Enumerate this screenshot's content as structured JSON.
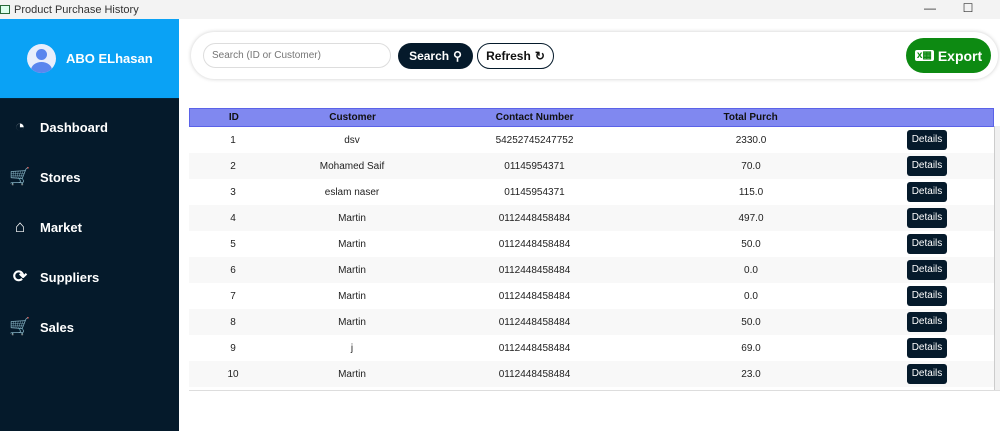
{
  "window": {
    "title": "Product Purchase History"
  },
  "sidebar": {
    "user": "ABO ELhasan",
    "items": [
      {
        "label": "Dashboard",
        "icon": "dashboard-icon"
      },
      {
        "label": "Stores",
        "icon": "cart-box-icon"
      },
      {
        "label": "Market",
        "icon": "store-icon"
      },
      {
        "label": "Suppliers",
        "icon": "supplier-cycle-icon"
      },
      {
        "label": "Sales",
        "icon": "sales-cart-icon"
      }
    ]
  },
  "toolbar": {
    "search_placeholder": "Search (ID or Customer)",
    "search_label": "Search",
    "refresh_label": "Refresh",
    "export_label": "Export"
  },
  "table": {
    "headers": [
      "ID",
      "Customer",
      "Contact Number",
      "Total Purch",
      ""
    ],
    "details_label": "Details",
    "rows": [
      [
        "1",
        "dsv",
        "54252745247752",
        "2330.0"
      ],
      [
        "2",
        "Mohamed Saif",
        "01145954371",
        "70.0"
      ],
      [
        "3",
        "eslam naser",
        "01145954371",
        "115.0"
      ],
      [
        "4",
        "Martin",
        "0112448458484",
        "497.0"
      ],
      [
        "5",
        "Martin",
        "0112448458484",
        "50.0"
      ],
      [
        "6",
        "Martin",
        "0112448458484",
        "0.0"
      ],
      [
        "7",
        "Martin",
        "0112448458484",
        "0.0"
      ],
      [
        "8",
        "Martin",
        "0112448458484",
        "50.0"
      ],
      [
        "9",
        "j",
        "0112448458484",
        "69.0"
      ],
      [
        "10",
        "Martin",
        "0112448458484",
        "23.0"
      ]
    ]
  }
}
